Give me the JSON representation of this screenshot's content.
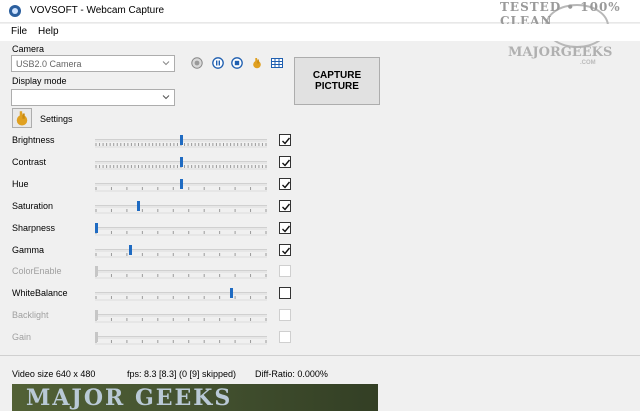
{
  "window": {
    "title": "VOVSOFT - Webcam Capture"
  },
  "menu": {
    "file": "File",
    "help": "Help"
  },
  "watermark": {
    "top": "TESTED • 100% CLEAN",
    "brand": "MAJORGEEKS",
    "sub": ".COM"
  },
  "camera": {
    "label": "Camera",
    "selected": "USB2.0 Camera"
  },
  "display_mode": {
    "label": "Display mode",
    "selected": ""
  },
  "toolbar": {
    "icons": [
      "record-icon",
      "pause-icon",
      "stop-icon",
      "settings-hand-icon",
      "grid-icon"
    ]
  },
  "capture_button": {
    "line1": "CAPTURE",
    "line2": "PICTURE"
  },
  "settings": {
    "label": "Settings"
  },
  "controls": [
    {
      "label": "Brightness",
      "level": 0.5,
      "enabled": true,
      "checked": true
    },
    {
      "label": "Contrast",
      "level": 0.5,
      "enabled": true,
      "checked": true
    },
    {
      "label": "Hue",
      "level": 0.5,
      "enabled": true,
      "checked": true
    },
    {
      "label": "Saturation",
      "level": 0.25,
      "enabled": true,
      "checked": true
    },
    {
      "label": "Sharpness",
      "level": 0.0,
      "enabled": true,
      "checked": true
    },
    {
      "label": "Gamma",
      "level": 0.2,
      "enabled": true,
      "checked": true
    },
    {
      "label": "ColorEnable",
      "level": 0.0,
      "enabled": false,
      "checked": false
    },
    {
      "label": "WhiteBalance",
      "level": 0.8,
      "enabled": true,
      "checked": false
    },
    {
      "label": "Backlight",
      "level": 0.0,
      "enabled": false,
      "checked": false
    },
    {
      "label": "Gain",
      "level": 0.0,
      "enabled": false,
      "checked": false
    }
  ],
  "status": {
    "video_size": "Video size 640 x 480",
    "fps": "fps: 8.3 [8.3] (0 [9] skipped)",
    "diff_ratio": "Diff-Ratio: 0.000%"
  },
  "preview": {
    "text": "MAJOR GEEKS"
  },
  "colors": {
    "accent": "#1f6bc2",
    "window_bg": "#f0f0f0"
  }
}
